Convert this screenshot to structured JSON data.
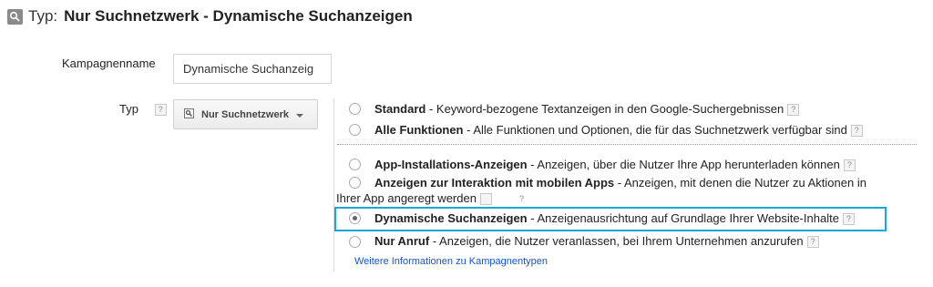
{
  "header": {
    "icon": "search-box-icon",
    "prefix": "Typ:",
    "title": "Nur Suchnetzwerk - Dynamische Suchanzeigen"
  },
  "form": {
    "campaign_name_label": "Kampagnenname",
    "campaign_name_value": "Dynamische Suchanzeig",
    "type_label": "Typ",
    "help_glyph": "?",
    "type_dropdown_label": "Nur Suchnetzwerk"
  },
  "options": [
    {
      "title": "Standard",
      "desc": " - Keyword-bezogene Textanzeigen in den Google-Suchergebnissen",
      "selected": false
    },
    {
      "title": "Alle Funktionen",
      "desc": " - Alle Funktionen und Optionen, die für das Suchnetzwerk verfügbar sind",
      "selected": false
    },
    {
      "title": "App-Installations-Anzeigen",
      "desc": " - Anzeigen, über die Nutzer Ihre App herunterladen können",
      "selected": false
    },
    {
      "title": "Anzeigen zur Interaktion mit mobilen Apps",
      "desc": " - Anzeigen, mit denen die Nutzer zu Aktionen in Ihrer App angeregt werden",
      "selected": false
    },
    {
      "title": "Dynamische Suchanzeigen",
      "desc": " - Anzeigenausrichtung auf Grundlage Ihrer Website-Inhalte",
      "selected": true
    },
    {
      "title": "Nur Anruf",
      "desc": " - Anzeigen, die Nutzer veranlassen, bei Ihrem Unternehmen anzurufen",
      "selected": false
    }
  ],
  "more_link": "Weitere Informationen zu Kampagnentypen",
  "colors": {
    "highlight": "#1aa6d6",
    "link": "#1155cc"
  }
}
